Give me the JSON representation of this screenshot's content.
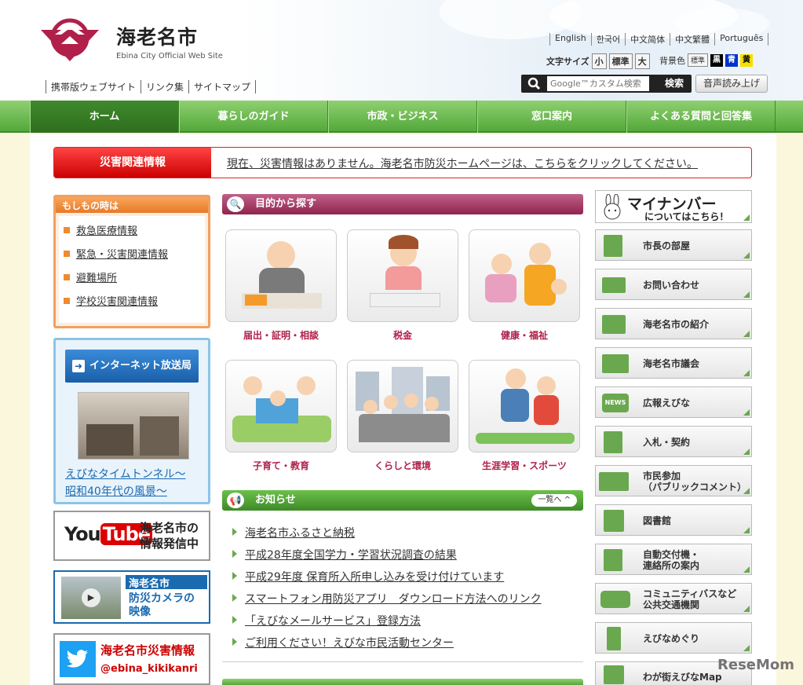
{
  "header": {
    "title": "海老名市",
    "subtitle": "Ebina City Official Web Site",
    "util_links": [
      "携帯版ウェブサイト",
      "リンク集",
      "サイトマップ"
    ],
    "languages": [
      "English",
      "한국어",
      "中文简体",
      "中文繁體",
      "Português"
    ],
    "fontsize_label": "文字サイズ",
    "fontsize_options": [
      "小",
      "標準",
      "大"
    ],
    "bgcolor_label": "背景色",
    "bgcolor_options": [
      "標準",
      "黒",
      "青",
      "黄"
    ],
    "search_placeholder": "Google™カスタム検索",
    "search_button": "検索",
    "voice_button": "音声読み上げ"
  },
  "nav": [
    "ホーム",
    "暮らしのガイド",
    "市政・ビジネス",
    "窓口案内",
    "よくある質問と回答集"
  ],
  "disaster": {
    "label": "災害関連情報",
    "text": "現在、災害情報はありません。海老名市防災ホームページは、こちらをクリックしてください。"
  },
  "emergency": {
    "title": "もしもの時は",
    "items": [
      "救急医療情報",
      "緊急・災害関連情報",
      "避難場所",
      "学校災害関連情報"
    ]
  },
  "internet": {
    "button": "インターネット放送局",
    "link_line1": "えびなタイムトンネル～",
    "link_line2": "昭和40年代の風景～"
  },
  "youtube": {
    "logo_you": "You",
    "logo_tube": "Tube",
    "line1": "海老名市の",
    "line2": "情報発信中"
  },
  "camera": {
    "head": "海老名市",
    "line1": "防災カメラの",
    "line2": "映像"
  },
  "twitter": {
    "line1": "海老名市災害情報",
    "handle": "@ebina_kikikanri"
  },
  "purpose": {
    "title": "目的から探す",
    "cards": [
      "届出・証明・相談",
      "税金",
      "健康・福祉",
      "子育て・教育",
      "くらしと環境",
      "生涯学習・スポーツ"
    ]
  },
  "news": {
    "title": "お知らせ",
    "all_label": "一覧へ",
    "items": [
      "海老名市ふるさと納税",
      "平成28年度全国学力・学習状況調査の結果",
      "平成29年度 保育所入所申し込みを受け付けています",
      "スマートフォン用防災アプリ　ダウンロード方法へのリンク",
      "「えびなメールサービス」登録方法",
      "ご利用ください！えびな市民活動センター"
    ]
  },
  "mynumber": {
    "line1": "マイナンバー",
    "line2": "についてはこちら！"
  },
  "sidebar": [
    {
      "label": "市長の部屋"
    },
    {
      "label": "お問い合わせ"
    },
    {
      "label": "海老名市の紹介"
    },
    {
      "label": "海老名市議会"
    },
    {
      "label": "広報えびな"
    },
    {
      "label": "入札・契約"
    },
    {
      "label": "市民参加\n（パブリックコメント）"
    },
    {
      "label": "図書館"
    },
    {
      "label": "自動交付機・\n連絡所の案内"
    },
    {
      "label": "コミュニティバスなど\n公共交通機関"
    },
    {
      "label": "えびなめぐり"
    },
    {
      "label": "わが街えびなMap"
    }
  ],
  "watermark": "ReseMom",
  "colors": {
    "nav_green": "#53a93a",
    "purpose_red": "#90244f",
    "alert_red": "#cc0000",
    "link_blue": "#1a6ab0"
  }
}
